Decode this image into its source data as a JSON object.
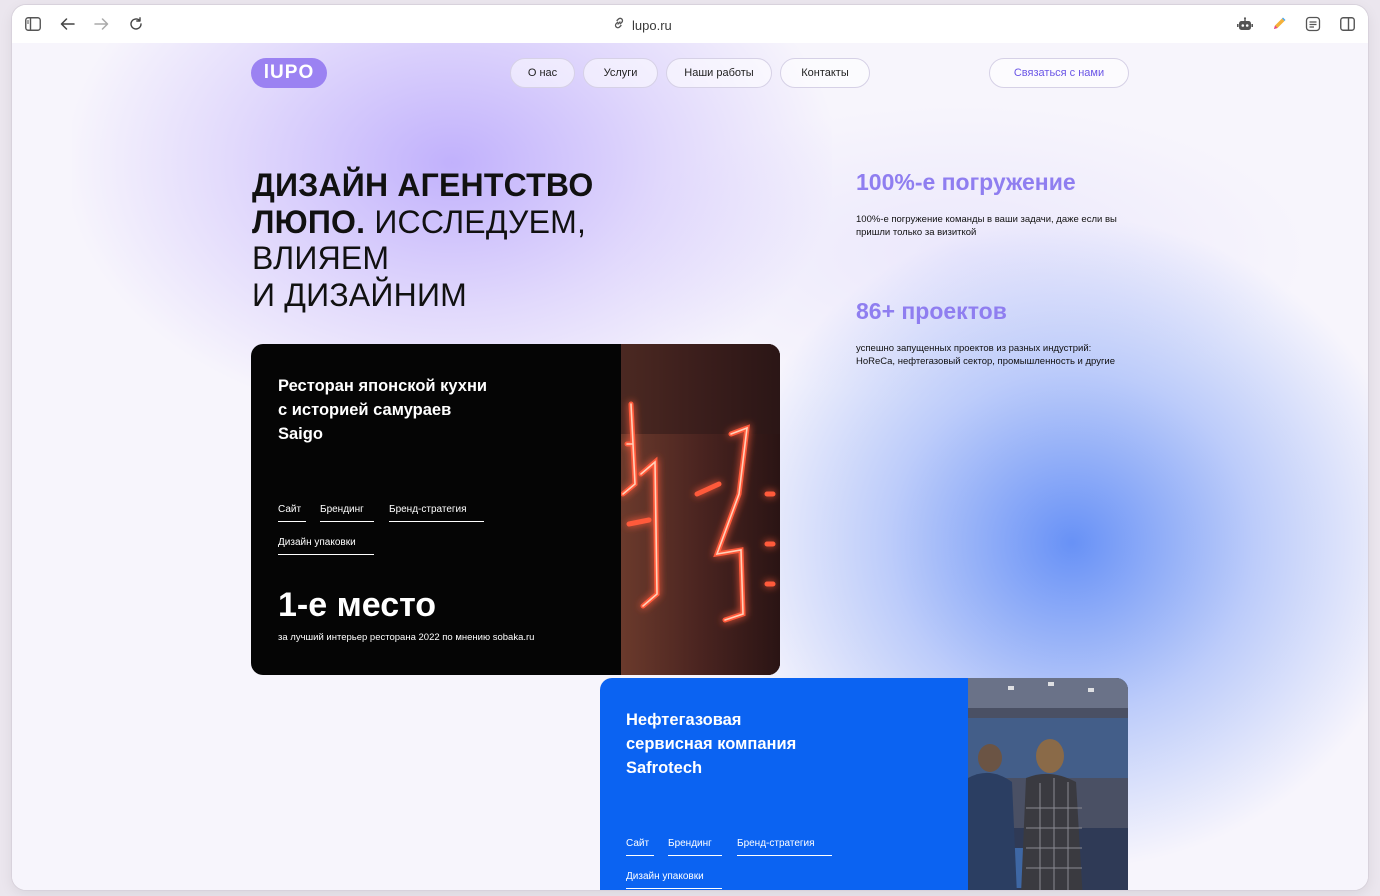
{
  "browser": {
    "url": "lupo.ru",
    "icons": [
      "sidebar-toggle-icon",
      "back-arrow-icon",
      "forward-arrow-icon",
      "reload-icon",
      "link-icon",
      "robot-extension-icon",
      "pencil-extension-icon",
      "reader-icon",
      "split-view-icon"
    ]
  },
  "nav": {
    "logo": "lUPO",
    "items": [
      {
        "label": "О нас"
      },
      {
        "label": "Услуги"
      },
      {
        "label": "Наши работы"
      },
      {
        "label": "Контакты"
      }
    ],
    "cta": "Связаться с нами"
  },
  "hero": {
    "line1": "ДИЗАЙН АГЕНТСТВО",
    "line2_bold": "ЛЮПО.",
    "line2_rest": " ИССЛЕДУЕМ,",
    "line3": "ВЛИЯЕМ",
    "line4": "И ДИЗАЙНИМ"
  },
  "stats": [
    {
      "title": "100%-е погружение",
      "desc": "100%-е погружение команды в ваши задачи, даже если вы пришли только за визиткой"
    },
    {
      "title": "86+ проектов",
      "desc": "успешно запущенных проектов из разных индустрий: HoReCa, нефтегазовый сектор, промышленность и другие"
    }
  ],
  "cases": [
    {
      "title_lines": [
        "Ресторан японской кухни",
        "с историей самураев",
        "Saigo"
      ],
      "tags": [
        "Сайт",
        "Брендинг",
        "Бренд-стратегия",
        "Дизайн упаковки"
      ],
      "award": "1-е место",
      "award_desc": "за лучший интерьер ресторана 2022 по мнению sobaka.ru"
    },
    {
      "title_lines": [
        "Нефтегазовая",
        "сервисная компания",
        "Safrotech"
      ],
      "tags": [
        "Сайт",
        "Брендинг",
        "Бренд-стратегия",
        "Дизайн упаковки"
      ]
    }
  ],
  "colors": {
    "accent": "#9b82f2",
    "stat_title": "#8f7ef0",
    "cta_text": "#6a55e6",
    "dark_card": "#050505",
    "blue_card": "#0b63f2"
  }
}
